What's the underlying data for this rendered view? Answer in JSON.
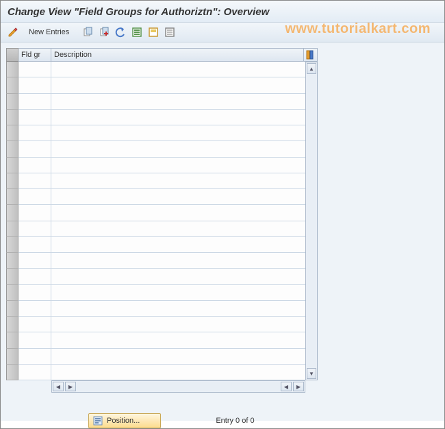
{
  "title": "Change View \"Field Groups for Authoriztn\": Overview",
  "toolbar": {
    "new_entries_label": "New Entries"
  },
  "watermark": "www.tutorialkart.com",
  "table": {
    "columns": {
      "fld_gr": "Fld gr",
      "description": "Description"
    },
    "row_count": 20
  },
  "footer": {
    "position_label": "Position...",
    "entry_text": "Entry 0 of 0"
  },
  "icons": {
    "pencil": "pencil-icon",
    "copy": "copy-icon",
    "delete": "delete-icon",
    "undo": "undo-icon",
    "select_all": "select-all-icon",
    "select_block": "select-block-icon",
    "deselect": "deselect-icon",
    "config": "config-icon",
    "position": "position-icon"
  }
}
